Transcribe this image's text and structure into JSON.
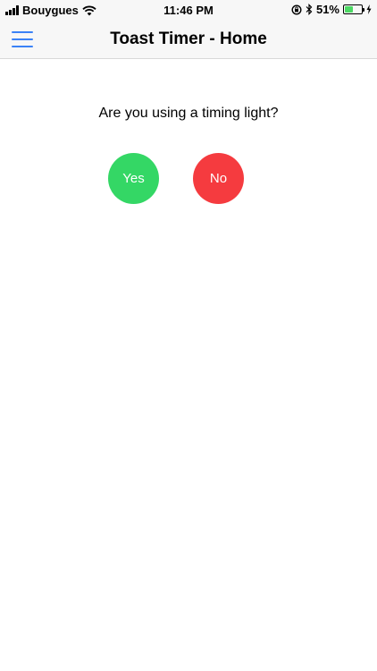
{
  "status_bar": {
    "carrier": "Bouygues",
    "time": "11:46 PM",
    "battery_percent": "51%",
    "battery_level": 0.51
  },
  "nav": {
    "title": "Toast Timer - Home"
  },
  "main": {
    "question": "Are you using a timing light?",
    "yes_label": "Yes",
    "no_label": "No"
  },
  "colors": {
    "accent": "#3b82f6",
    "yes": "#34d765",
    "no": "#f53b3f",
    "battery": "#4cd964"
  }
}
